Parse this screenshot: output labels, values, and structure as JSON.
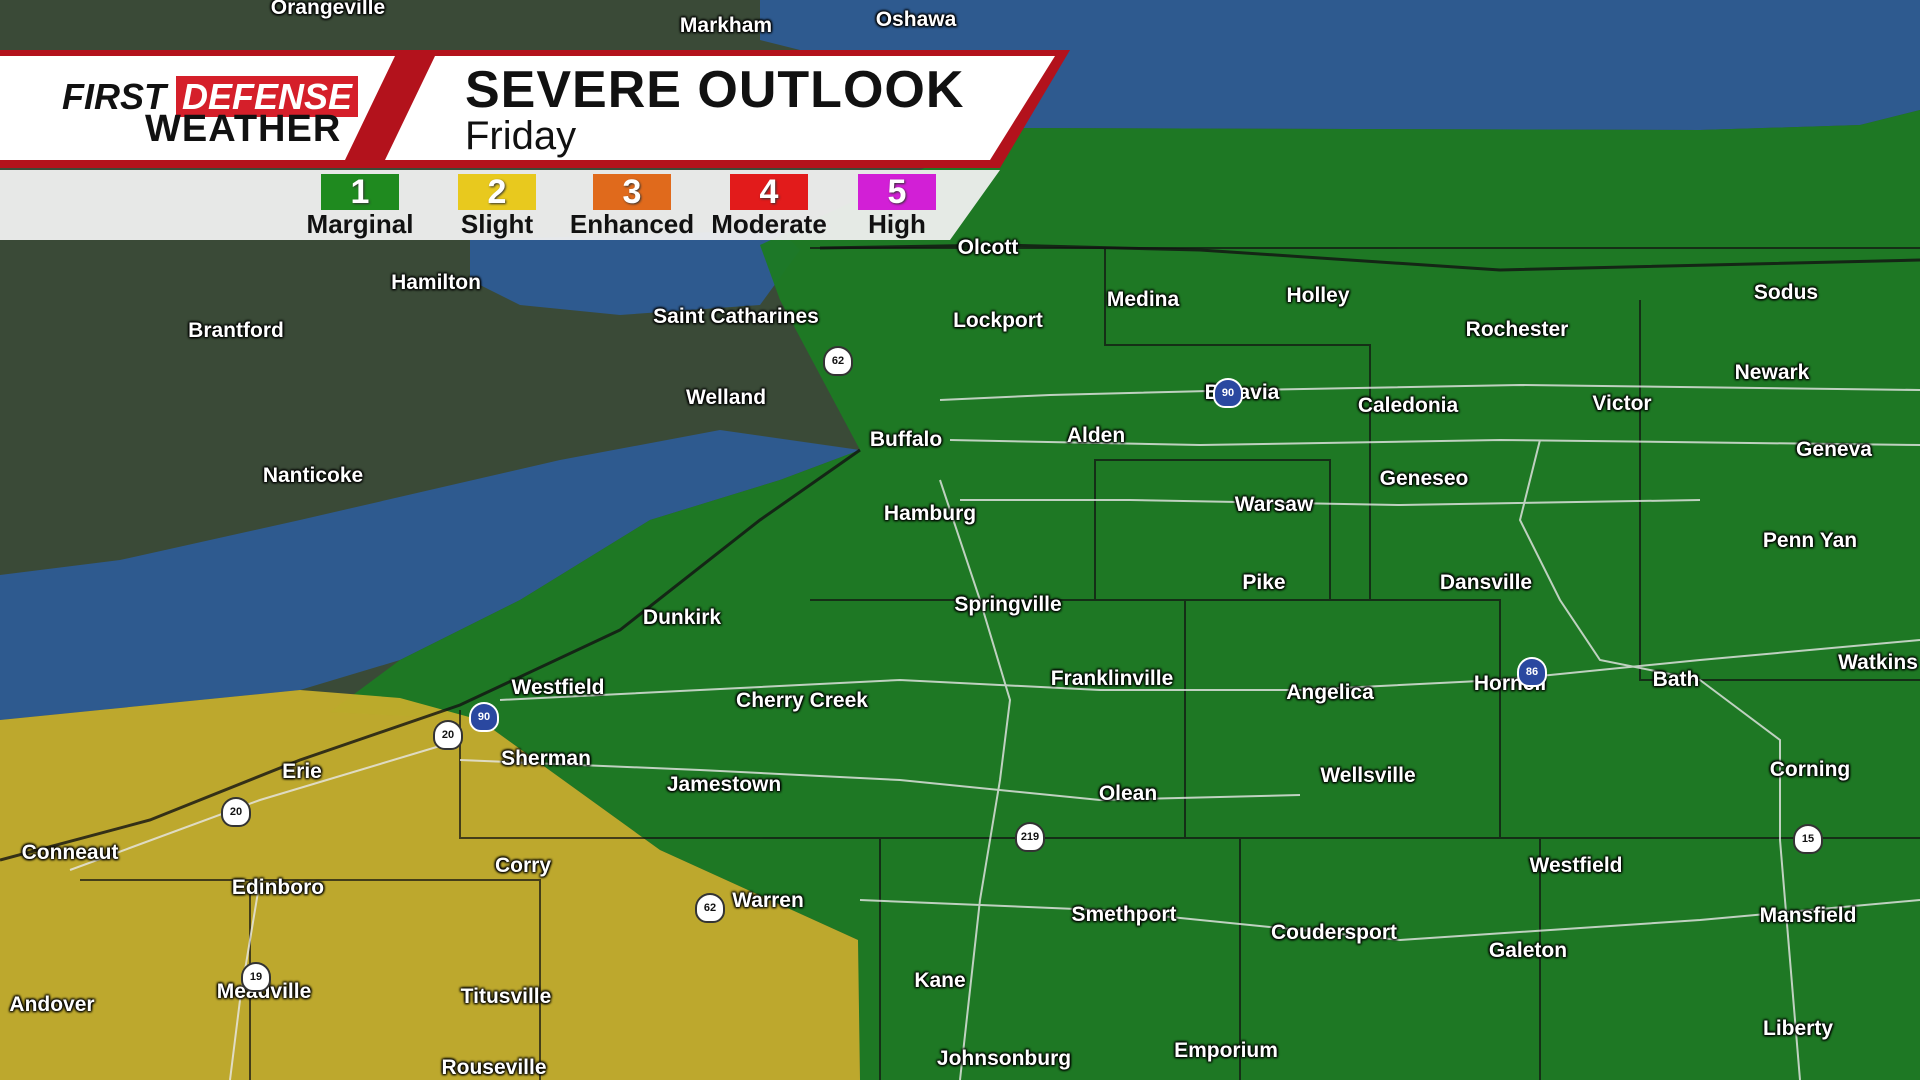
{
  "header": {
    "brand_line1_a": "FIRST",
    "brand_line1_b": "DEFENSE",
    "brand_line2": "WEATHER",
    "title": "SEVERE OUTLOOK",
    "subtitle": "Friday"
  },
  "legend": [
    {
      "num": "1",
      "label": "Marginal",
      "color": "#1f8a1f"
    },
    {
      "num": "2",
      "label": "Slight",
      "color": "#e8c91e"
    },
    {
      "num": "3",
      "label": "Enhanced",
      "color": "#e06a1c"
    },
    {
      "num": "4",
      "label": "Moderate",
      "color": "#e21b1b"
    },
    {
      "num": "5",
      "label": "High",
      "color": "#d21fd6"
    }
  ],
  "colors": {
    "marginal_zone": "#1c7a23",
    "slight_zone": "#c4ad2c",
    "lake": "#2e5a8f",
    "land": "#3c4a38",
    "header_red": "#b3121c"
  },
  "cities": {
    "c1": "Orangeville",
    "c2": "Markham",
    "c3": "Oshawa",
    "c4": "Olcott",
    "c5": "Hamilton",
    "c6": "Saint Catharines",
    "c7": "Lockport",
    "c8": "Medina",
    "c9": "Holley",
    "c10": "Rochester",
    "c11": "Sodus",
    "c12": "Brantford",
    "c13": "Welland",
    "c14": "Batavia",
    "c15": "Caledonia",
    "c16": "Victor",
    "c17": "Newark",
    "c18": "Buffalo",
    "c19": "Alden",
    "c20": "Geneva",
    "c21": "Nanticoke",
    "c22": "Geneseo",
    "c23": "Hamburg",
    "c24": "Warsaw",
    "c25": "Penn Yan",
    "c26": "Pike",
    "c27": "Dansville",
    "c28": "Springville",
    "c29": "Dunkirk",
    "c30": "Watkins",
    "c31": "Franklinville",
    "c32": "Westfield",
    "c33": "Cherry Creek",
    "c34": "Angelica",
    "c35": "Hornell",
    "c36": "Bath",
    "c37": "Erie",
    "c38": "Sherman",
    "c39": "Jamestown",
    "c40": "Olean",
    "c41": "Wellsville",
    "c42": "Corning",
    "c43": "Conneaut",
    "c44": "Corry",
    "c45": "Westfield",
    "c46": "Edinboro",
    "c47": "Warren",
    "c48": "Smethport",
    "c49": "Mansfield",
    "c50": "Coudersport",
    "c51": "Galeton",
    "c52": "Meadville",
    "c53": "Kane",
    "c54": "Andover",
    "c55": "Titusville",
    "c56": "Liberty",
    "c57": "Emporium",
    "c58": "Johnsonburg",
    "c59": "Rouseville"
  },
  "shields": {
    "s1": "62",
    "s2": "90",
    "s3": "20",
    "s4": "20",
    "s5": "219",
    "s6": "90",
    "s7": "86",
    "s8": "15",
    "s9": "62",
    "s10": "19"
  }
}
